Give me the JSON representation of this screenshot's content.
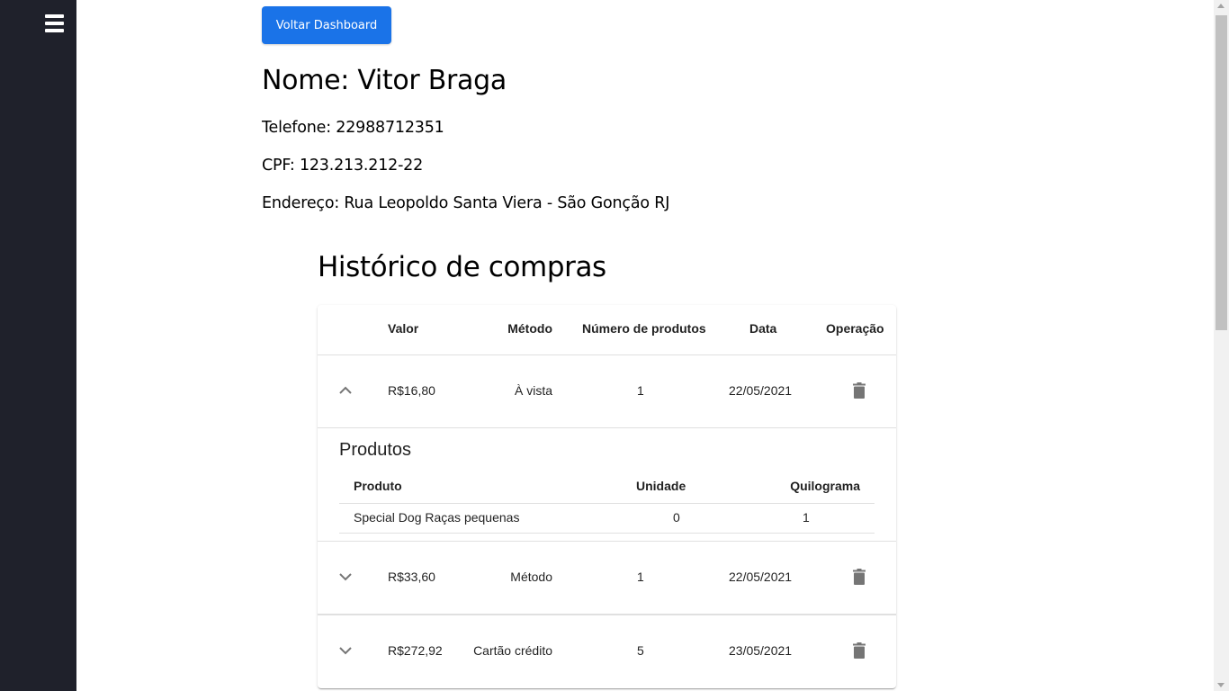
{
  "back_button_label": "Voltar Dashboard",
  "customer": {
    "name": "Nome: Vitor Braga",
    "phone": "Telefone: 22988712351",
    "cpf": "CPF: 123.213.212-22",
    "address": "Endereço: Rua Leopoldo Santa Viera - São Gonção RJ"
  },
  "history": {
    "title": "Histórico de compras",
    "columns": [
      "Valor",
      "Método",
      "Número de produtos",
      "Data",
      "Operação"
    ],
    "rows": [
      {
        "valor": "R$16,80",
        "metodo": "À vista",
        "numero": "1",
        "data": "22/05/2021",
        "expanded": true
      },
      {
        "valor": "R$33,60",
        "metodo": "Método",
        "numero": "1",
        "data": "22/05/2021",
        "expanded": false
      },
      {
        "valor": "R$272,92",
        "metodo": "Cartão crédito",
        "numero": "5",
        "data": "23/05/2021",
        "expanded": false
      }
    ],
    "products": {
      "title": "Produtos",
      "columns": [
        "Produto",
        "Unidade",
        "Quilograma"
      ],
      "rows": [
        {
          "produto": "Special Dog Raças pequenas",
          "unidade": "0",
          "quilograma": "1"
        }
      ]
    }
  },
  "icons": {
    "menu": "hamburger-menu-icon",
    "expand": "chevron-icon",
    "delete": "trash-icon"
  },
  "colors": {
    "sidebar": "#1f212b",
    "primary_button": "#1a73e8",
    "icon_gray": "#757575"
  }
}
